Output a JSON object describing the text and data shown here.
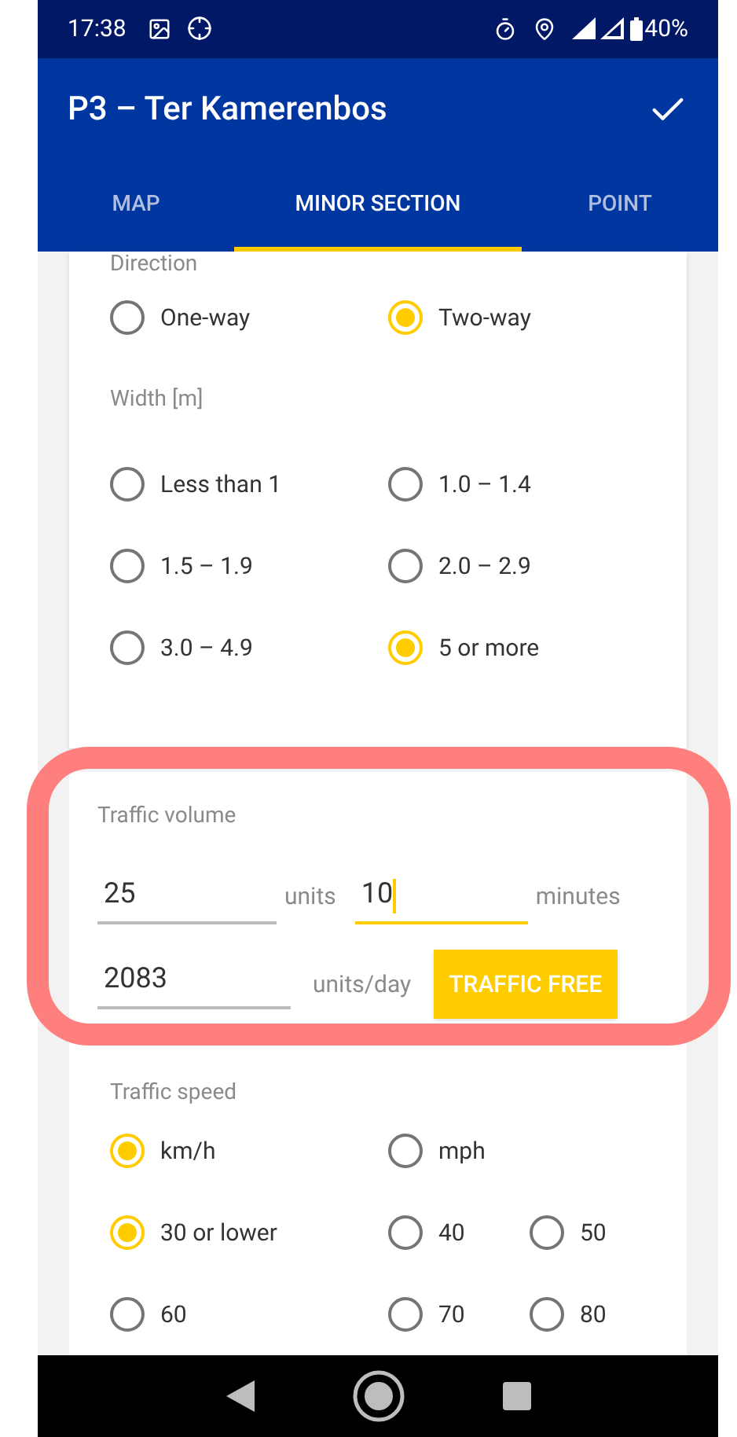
{
  "status_bar": {
    "time": "17:38",
    "battery": "40%"
  },
  "app_bar": {
    "title": "P3 – Ter Kamerenbos"
  },
  "tabs": [
    {
      "label": "MAP",
      "selected": false
    },
    {
      "label": "MINOR SECTION",
      "selected": true
    },
    {
      "label": "POINT",
      "selected": false
    }
  ],
  "direction": {
    "label": "Direction",
    "options": [
      {
        "label": "One-way",
        "selected": false
      },
      {
        "label": "Two-way",
        "selected": true
      }
    ]
  },
  "width": {
    "label": "Width [m]",
    "options": [
      {
        "label": "Less than 1",
        "selected": false
      },
      {
        "label": "1.0 – 1.4",
        "selected": false
      },
      {
        "label": "1.5 – 1.9",
        "selected": false
      },
      {
        "label": "2.0 – 2.9",
        "selected": false
      },
      {
        "label": "3.0 – 4.9",
        "selected": false
      },
      {
        "label": "5 or more",
        "selected": true
      }
    ]
  },
  "traffic_volume": {
    "label": "Traffic volume",
    "count": {
      "value": "25",
      "unit": "units",
      "focused": false
    },
    "period": {
      "value": "10",
      "unit": "minutes",
      "focused": true
    },
    "daily": {
      "value": "2083",
      "unit": "units/day",
      "focused": false
    },
    "button": "TRAFFIC FREE"
  },
  "traffic_speed": {
    "label": "Traffic speed",
    "units": [
      {
        "label": "km/h",
        "selected": true
      },
      {
        "label": "mph",
        "selected": false
      }
    ],
    "speeds": [
      {
        "label": "30 or lower",
        "selected": true
      },
      {
        "label": "40",
        "selected": false
      },
      {
        "label": "50",
        "selected": false
      },
      {
        "label": "60",
        "selected": false
      },
      {
        "label": "70",
        "selected": false
      },
      {
        "label": "80",
        "selected": false
      }
    ]
  }
}
